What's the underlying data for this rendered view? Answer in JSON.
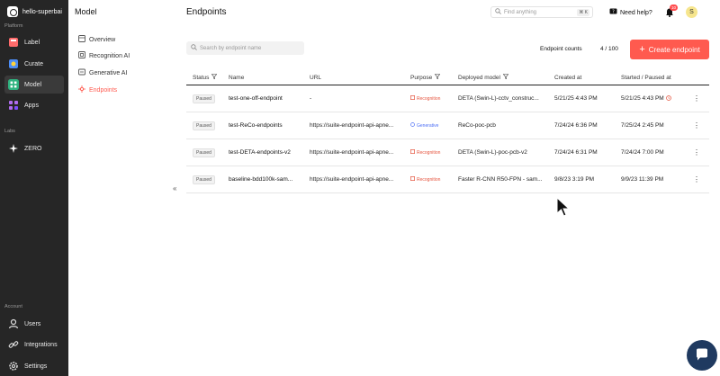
{
  "workspace": {
    "name": "hello-superbai"
  },
  "sidebar": {
    "platform_label": "Platform",
    "labs_label": "Labs",
    "account_label": "Account",
    "items": [
      {
        "label": "Label",
        "icon": "label-icon"
      },
      {
        "label": "Curate",
        "icon": "curate-icon"
      },
      {
        "label": "Model",
        "icon": "model-icon"
      },
      {
        "label": "Apps",
        "icon": "apps-icon"
      }
    ],
    "labs_items": [
      {
        "label": "ZERO",
        "icon": "sparkle-icon"
      }
    ],
    "account_items": [
      {
        "label": "Users",
        "icon": "user-icon"
      },
      {
        "label": "Integrations",
        "icon": "link-icon"
      },
      {
        "label": "Settings",
        "icon": "gear-icon"
      }
    ]
  },
  "subnav": {
    "title": "Model",
    "items": [
      {
        "label": "Overview",
        "icon": "overview-icon"
      },
      {
        "label": "Recognition AI",
        "icon": "recognition-icon"
      },
      {
        "label": "Generative AI",
        "icon": "generative-icon"
      },
      {
        "label": "Endpoints",
        "icon": "endpoints-icon"
      }
    ],
    "collapse_glyph": "«"
  },
  "header": {
    "title": "Endpoints",
    "search_placeholder": "Find anything",
    "shortcut": "⌘ K",
    "help_label": "Need help?",
    "notification_count": "10",
    "avatar_initial": "S"
  },
  "toolbar": {
    "search_placeholder": "Search by endpoint name",
    "count_label": "Endpoint counts",
    "count_value": "4 / 100",
    "create_label": "Create endpoint"
  },
  "table": {
    "columns": {
      "status": "Status",
      "name": "Name",
      "url": "URL",
      "purpose": "Purpose",
      "model": "Deployed model",
      "created": "Created at",
      "started": "Started / Paused at"
    },
    "rows": [
      {
        "status": "Paused",
        "name": "test-one-off-endpoint",
        "url": "-",
        "purpose": "Recognition",
        "purpose_type": "rec",
        "model": "DETA (Swin-L)-cctv_construc...",
        "created": "5/21/25 4:43 PM",
        "started": "5/21/25 4:43 PM",
        "warn": true
      },
      {
        "status": "Paused",
        "name": "test-ReCo-endpoints",
        "url": "https://suite-endpoint-api-apne...",
        "purpose": "Generative",
        "purpose_type": "gen",
        "model": "ReCo-poc-pcb",
        "created": "7/24/24 6:36 PM",
        "started": "7/25/24 2:45 PM",
        "warn": false
      },
      {
        "status": "Paused",
        "name": "test-DETA-endpoints-v2",
        "url": "https://suite-endpoint-api-apne...",
        "purpose": "Recognition",
        "purpose_type": "rec",
        "model": "DETA (Swin-L)-poc-pcb-v2",
        "created": "7/24/24 6:31 PM",
        "started": "7/24/24 7:00 PM",
        "warn": false
      },
      {
        "status": "Paused",
        "name": "baseline-bdd100k-sam...",
        "url": "https://suite-endpoint-api-apne...",
        "purpose": "Recognition",
        "purpose_type": "rec",
        "model": "Faster R-CNN R50-FPN - sam...",
        "created": "9/8/23 3:19 PM",
        "started": "9/9/23 11:39 PM",
        "warn": false
      }
    ]
  },
  "colors": {
    "accent": "#ff5a4f",
    "sidebar_bg": "#262626",
    "generative": "#4c6ef5",
    "recognition": "#e5533d"
  }
}
